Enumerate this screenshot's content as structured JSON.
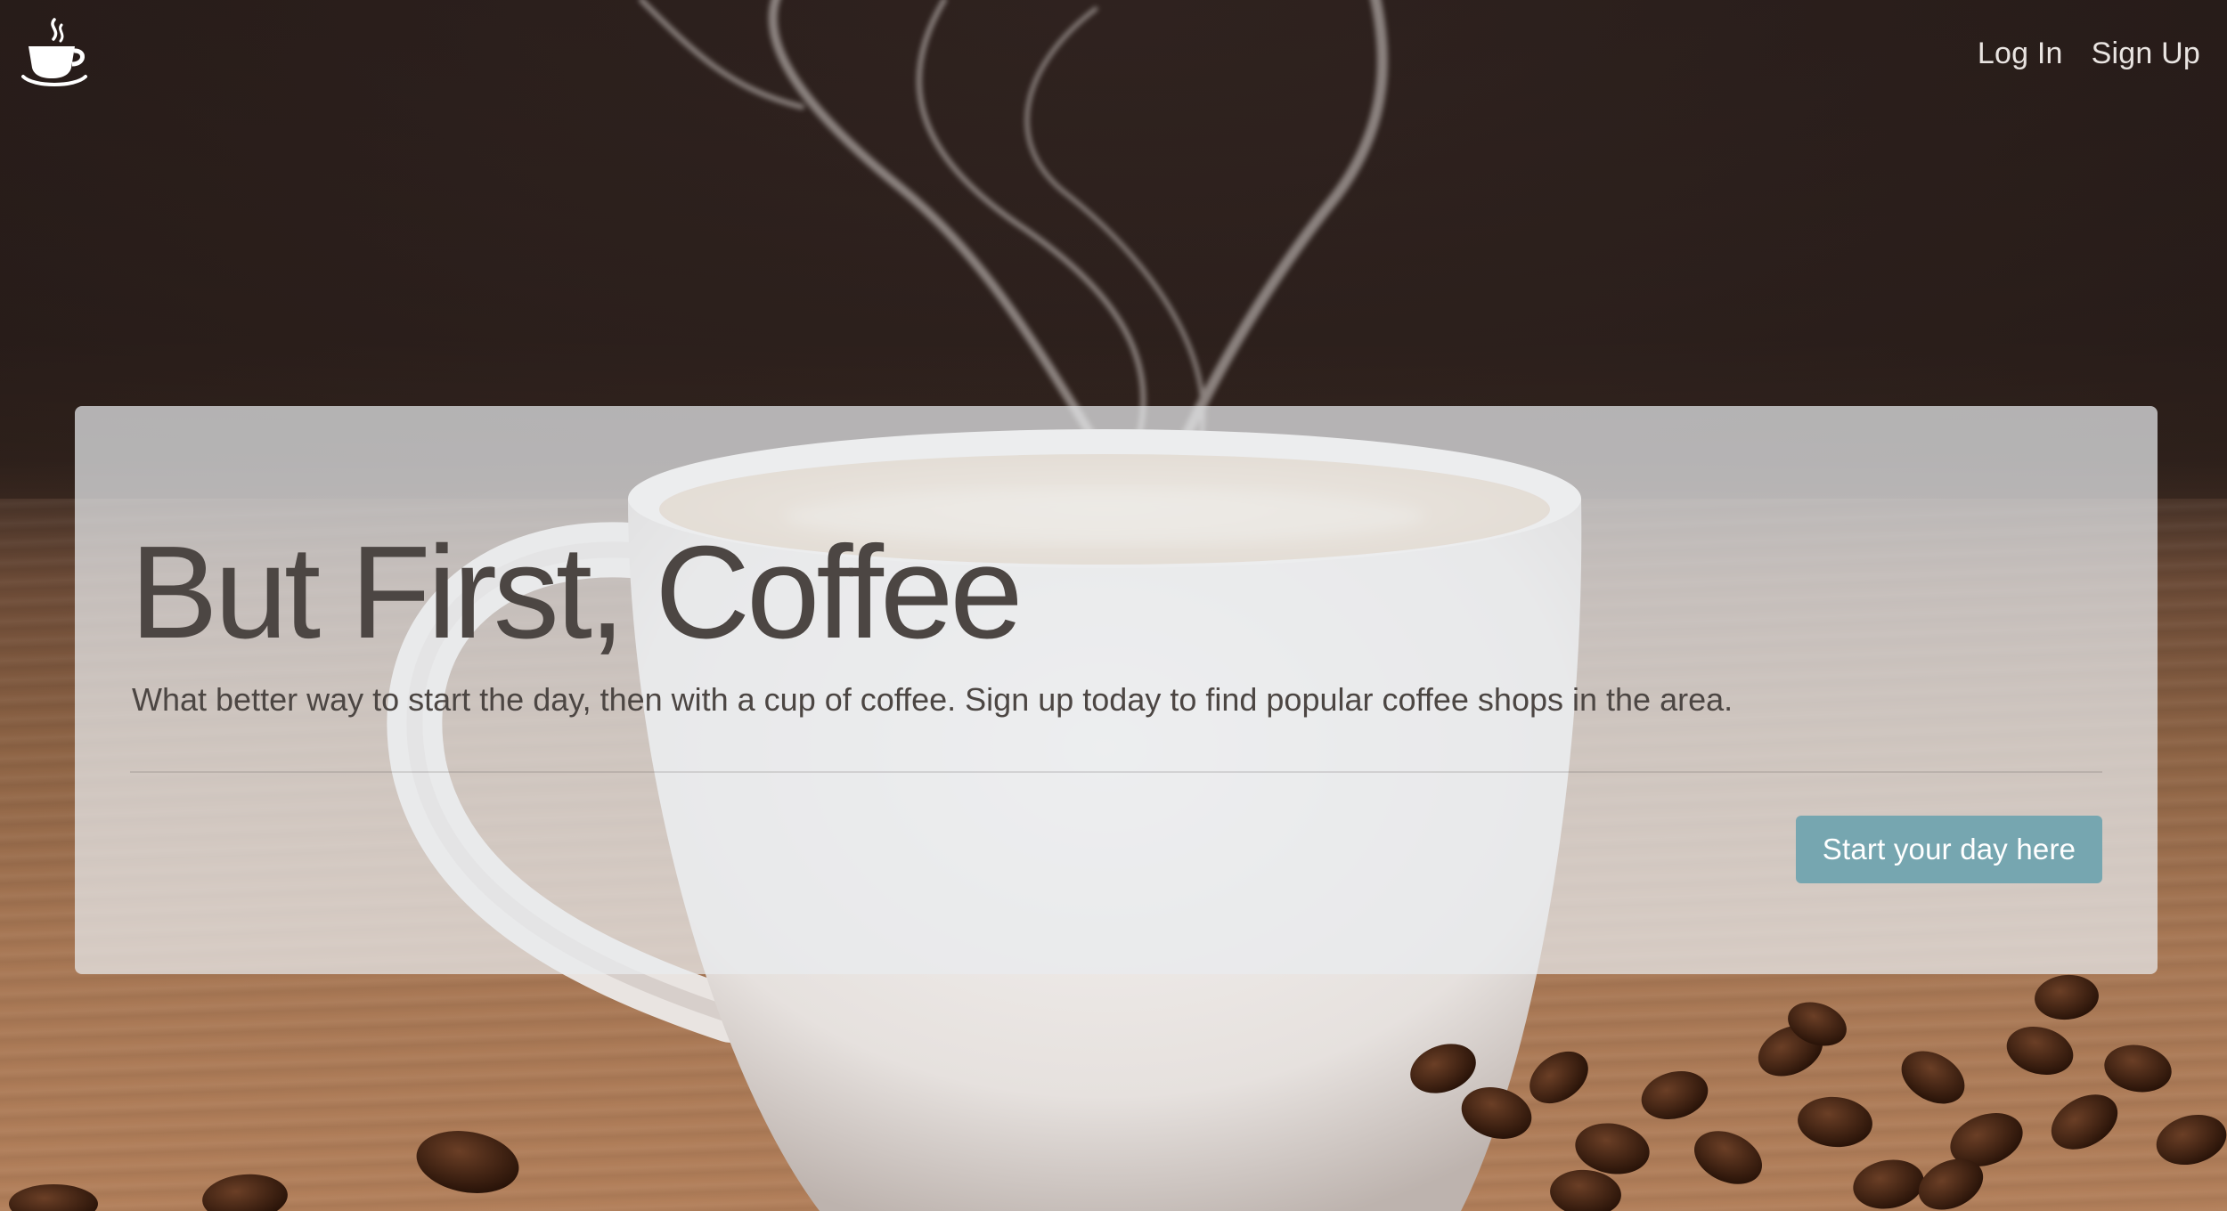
{
  "navbar": {
    "brand_icon": "coffee-cup-icon",
    "links": [
      {
        "label": "Log In"
      },
      {
        "label": "Sign Up"
      }
    ]
  },
  "jumbotron": {
    "title": "But First, Coffee",
    "lead": "What better way to start the day, then with a cup of coffee. Sign up today to find popular coffee shops in the area.",
    "cta_label": "Start your day here"
  },
  "colors": {
    "accent": "#76a6b0",
    "text": "#4c4643",
    "nav_text": "#e9e4e1",
    "panel": "rgba(233,236,239,0.72)"
  }
}
